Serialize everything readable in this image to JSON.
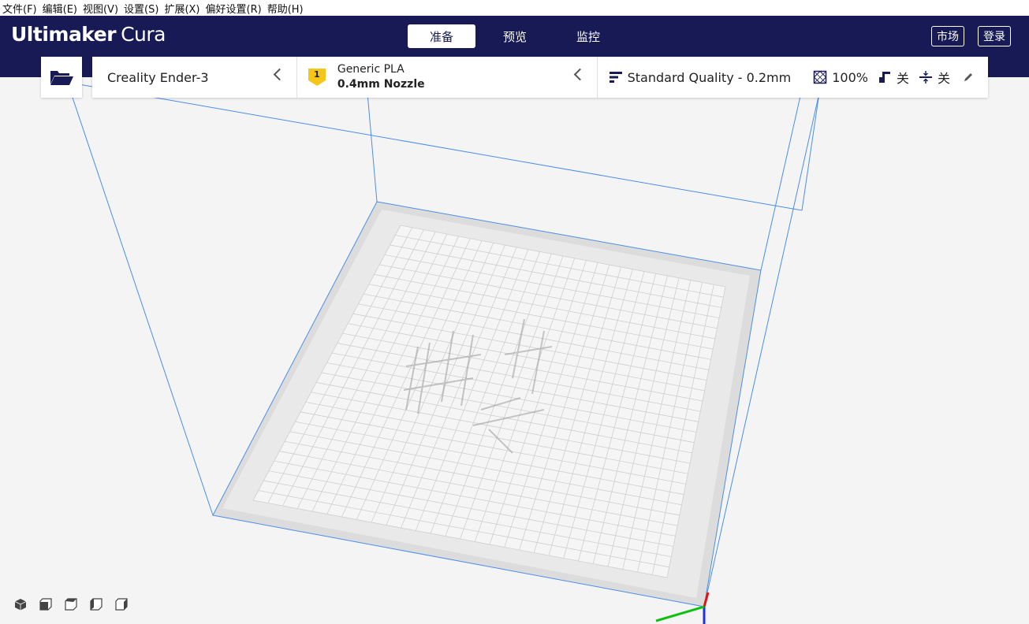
{
  "menu": [
    "文件(F)",
    "编辑(E)",
    "视图(V)",
    "设置(S)",
    "扩展(X)",
    "偏好设置(R)",
    "帮助(H)"
  ],
  "app": {
    "brand_bold": "Ultimaker",
    "brand_light": "Cura"
  },
  "stages": [
    {
      "label": "准备",
      "active": true
    },
    {
      "label": "预览",
      "active": false
    },
    {
      "label": "监控",
      "active": false
    }
  ],
  "header_buttons": {
    "marketplace": "市场",
    "login": "登录"
  },
  "printer": {
    "name": "Creality Ender-3"
  },
  "material": {
    "extruder_index": "1",
    "name": "Generic PLA",
    "nozzle": "0.4mm Nozzle"
  },
  "print_settings": {
    "quality": "Standard Quality - 0.2mm",
    "infill": "100%",
    "support": "关",
    "adhesion": "关"
  },
  "icons": [
    "folder-open-icon",
    "chevron-left-icon",
    "extruder-badge-icon",
    "quality-bars-icon",
    "infill-icon",
    "support-icon",
    "adhesion-icon",
    "pencil-icon",
    "view-3d-icon",
    "view-front-icon",
    "view-top-icon",
    "view-left-icon",
    "view-right-icon"
  ],
  "colors": {
    "header_bg": "#171a55",
    "accent_badge": "#f5c518",
    "build_volume_line": "#4a8ee8",
    "axis_x": "#e81010",
    "axis_y": "#10c010",
    "axis_z": "#2030e0"
  }
}
